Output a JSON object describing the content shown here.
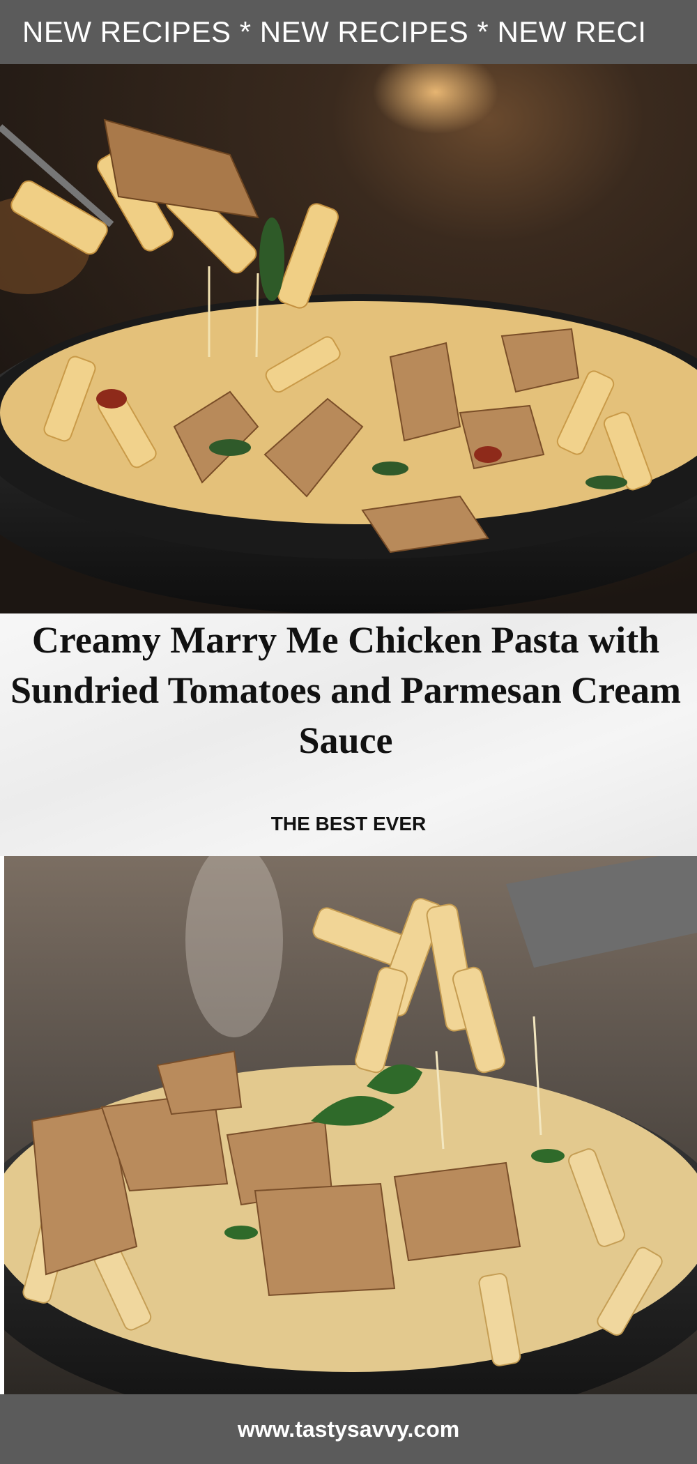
{
  "top_banner": {
    "text": "NEW RECIPES * NEW RECIPES * NEW  RECI"
  },
  "images": {
    "top": {
      "description_icon": "pasta-pan-photo"
    },
    "bottom": {
      "description_icon": "pasta-pan-photo"
    }
  },
  "recipe": {
    "title": "Creamy Marry Me Chicken Pasta with Sundried Tomatoes and Parmesan Cream Sauce",
    "tagline": "THE BEST EVER"
  },
  "footer": {
    "url": "www.tastysavvy.com"
  },
  "colors": {
    "banner": "#5b5b5b",
    "text": "#111111",
    "banner_text": "#ffffff"
  }
}
